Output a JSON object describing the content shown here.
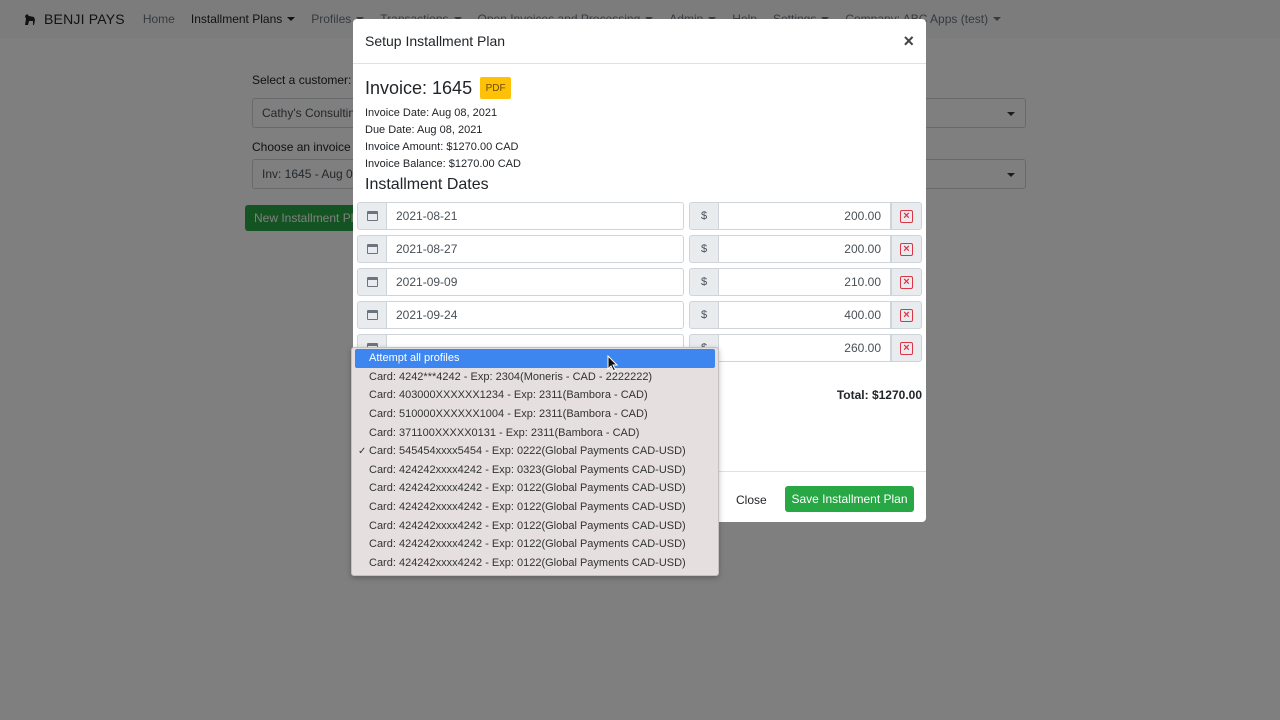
{
  "navbar": {
    "brand": "BENJI PAYS",
    "items": [
      {
        "label": "Home",
        "active": false,
        "dropdown": false
      },
      {
        "label": "Installment Plans",
        "active": true,
        "dropdown": true
      },
      {
        "label": "Profiles",
        "active": false,
        "dropdown": true
      },
      {
        "label": "Transactions",
        "active": false,
        "dropdown": true
      },
      {
        "label": "Open Invoices and Processing",
        "active": false,
        "dropdown": true
      },
      {
        "label": "Admin",
        "active": false,
        "dropdown": true
      },
      {
        "label": "Help",
        "active": false,
        "dropdown": false
      },
      {
        "label": "Settings",
        "active": false,
        "dropdown": true
      },
      {
        "label": "Company: ABC Apps (test)",
        "active": false,
        "dropdown": true
      }
    ]
  },
  "background": {
    "customer_label": "Select a customer:",
    "customer_value": "Cathy's Consulting",
    "invoice_label": "Choose an invoice to",
    "invoice_value": "Inv: 1645 - Aug 08",
    "new_plan_button": "New Installment Plan"
  },
  "modal": {
    "title": "Setup Installment Plan",
    "close_glyph": "×",
    "invoice_title": "Invoice: 1645",
    "pdf_label": "PDF",
    "invoice_date": "Invoice Date: Aug 08, 2021",
    "due_date": "Due Date: Aug 08, 2021",
    "invoice_amount": "Invoice Amount: $1270.00 CAD",
    "invoice_balance": "Invoice Balance: $1270.00 CAD",
    "dates_heading": "Installment Dates",
    "currency_symbol": "$",
    "remove_glyph": "×",
    "installments": [
      {
        "date": "2021-08-21",
        "amount": "200.00"
      },
      {
        "date": "2021-08-27",
        "amount": "200.00"
      },
      {
        "date": "2021-09-09",
        "amount": "210.00"
      },
      {
        "date": "2021-09-24",
        "amount": "400.00"
      },
      {
        "date": "",
        "amount": "260.00"
      }
    ],
    "total": "Total: $1270.00",
    "close_button": "Close",
    "save_button": "Save Installment Plan"
  },
  "profile_dropdown": {
    "highlighted": "Attempt all profiles",
    "check_glyph": "✓",
    "options": [
      {
        "label": "Attempt all profiles",
        "highlighted": true,
        "checked": false
      },
      {
        "label": "Card: 4242***4242 - Exp: 2304(Moneris - CAD - 2222222)",
        "highlighted": false,
        "checked": false
      },
      {
        "label": "Card: 403000XXXXXX1234 - Exp: 2311(Bambora - CAD)",
        "highlighted": false,
        "checked": false
      },
      {
        "label": "Card: 510000XXXXXX1004 - Exp: 2311(Bambora - CAD)",
        "highlighted": false,
        "checked": false
      },
      {
        "label": "Card: 371100XXXXX0131 - Exp: 2311(Bambora - CAD)",
        "highlighted": false,
        "checked": false
      },
      {
        "label": "Card: 545454xxxx5454 - Exp: 0222(Global Payments CAD-USD)",
        "highlighted": false,
        "checked": true
      },
      {
        "label": "Card: 424242xxxx4242 - Exp: 0323(Global Payments CAD-USD)",
        "highlighted": false,
        "checked": false
      },
      {
        "label": "Card: 424242xxxx4242 - Exp: 0122(Global Payments CAD-USD)",
        "highlighted": false,
        "checked": false
      },
      {
        "label": "Card: 424242xxxx4242 - Exp: 0122(Global Payments CAD-USD)",
        "highlighted": false,
        "checked": false
      },
      {
        "label": "Card: 424242xxxx4242 - Exp: 0122(Global Payments CAD-USD)",
        "highlighted": false,
        "checked": false
      },
      {
        "label": "Card: 424242xxxx4242 - Exp: 0122(Global Payments CAD-USD)",
        "highlighted": false,
        "checked": false
      },
      {
        "label": "Card: 424242xxxx4242 - Exp: 0122(Global Payments CAD-USD)",
        "highlighted": false,
        "checked": false
      }
    ]
  },
  "colors": {
    "primary_green": "#28a745",
    "pdf_yellow": "#ffc107",
    "highlight_blue": "#3d86f0",
    "danger_red": "#dc3545"
  }
}
